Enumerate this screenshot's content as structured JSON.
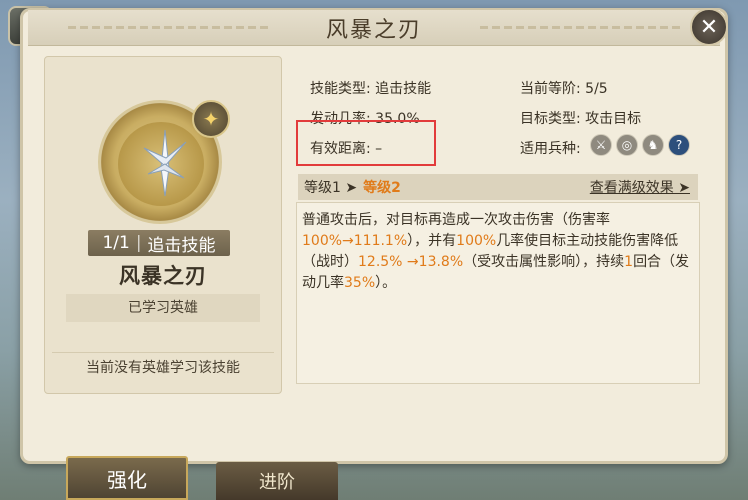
{
  "window": {
    "title": "风暴之刃",
    "close_label": "✕",
    "share_label": "⇪"
  },
  "left": {
    "level_count": "1/1",
    "level_sep": "|",
    "skill_category": "追击技能",
    "skill_name": "风暴之刃",
    "learned_button": "已学习英雄",
    "no_hero_text": "当前没有英雄学习该技能"
  },
  "info": {
    "skill_type": "技能类型: 追击技能",
    "current_tier": "当前等阶: 5/5",
    "trigger_rate": "发动几率: 35.0%",
    "target_type": "目标类型: 攻击目标",
    "range": "有效距离: –",
    "troop_label": "适用兵种:"
  },
  "troop_icons": [
    "sword-icon",
    "bow-icon",
    "horse-icon",
    "question-icon"
  ],
  "level_strip": {
    "level1": "等级1 ➤",
    "level2": "等级2",
    "full_effect": "查看满级效果 ➤"
  },
  "description": {
    "p1": "普通攻击后，对目标再造成一次攻击伤害（伤害率",
    "v1": "100%",
    "v1b": "→111.1%",
    "p2": "），并有",
    "v2": "100%",
    "p3": "几率使目标主动技能伤害降低（战时）",
    "v3": "12.5% →13.8%",
    "p4": "（受攻击属性影响），持续",
    "v4": "1",
    "p5": "回合（发动几率",
    "v5": "35%",
    "p6": "）。"
  },
  "tabs": {
    "active": "强化",
    "normal": "进阶"
  },
  "colors": {
    "accent": "#e07b1a",
    "highlight_box": "#e23b3b",
    "panel": "#f2ecdc"
  }
}
